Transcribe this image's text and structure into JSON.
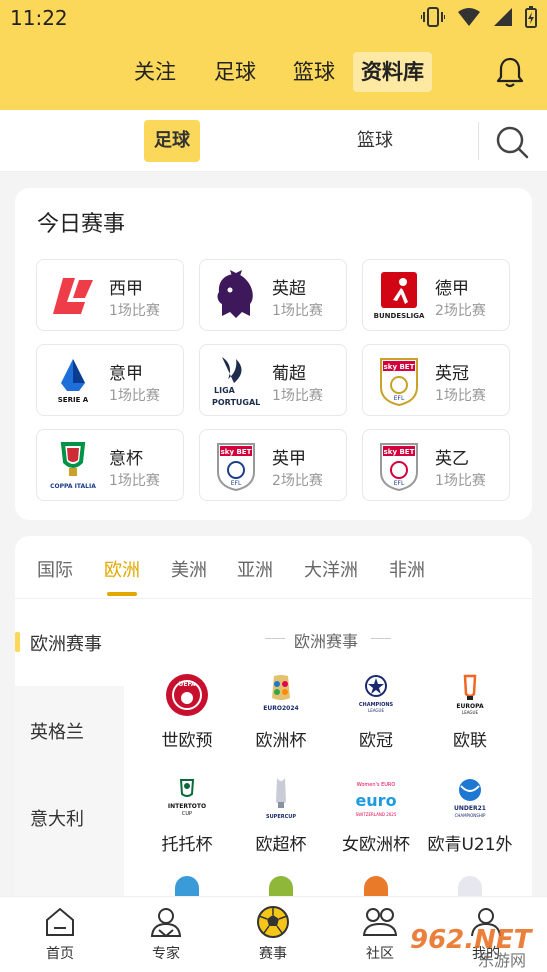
{
  "status": {
    "time": "11:22"
  },
  "header": {
    "tabs": [
      {
        "label": "关注"
      },
      {
        "label": "足球"
      },
      {
        "label": "篮球"
      },
      {
        "label": "资料库"
      }
    ]
  },
  "subtabs": [
    {
      "label": "足球"
    },
    {
      "label": "篮球"
    }
  ],
  "today": {
    "title": "今日赛事",
    "leagues": [
      {
        "name": "西甲",
        "count": "1场比赛",
        "logo": "laliga-logo"
      },
      {
        "name": "英超",
        "count": "1场比赛",
        "logo": "premier-league-logo"
      },
      {
        "name": "德甲",
        "count": "2场比赛",
        "logo": "bundesliga-logo",
        "logo_text": "BUNDESLIGA"
      },
      {
        "name": "意甲",
        "count": "1场比赛",
        "logo": "serie-a-logo",
        "logo_text": "SERIE A"
      },
      {
        "name": "葡超",
        "count": "1场比赛",
        "logo": "liga-portugal-logo",
        "logo_text": "LIGA PORTUGAL"
      },
      {
        "name": "英冠",
        "count": "1场比赛",
        "logo": "efl-championship-logo",
        "logo_text": "sky BET"
      },
      {
        "name": "意杯",
        "count": "1场比赛",
        "logo": "coppa-italia-logo",
        "logo_text": "COPPA ITALIA"
      },
      {
        "name": "英甲",
        "count": "2场比赛",
        "logo": "efl-league-one-logo",
        "logo_text": "sky BET"
      },
      {
        "name": "英乙",
        "count": "1场比赛",
        "logo": "efl-league-two-logo",
        "logo_text": "sky BET"
      }
    ]
  },
  "regions": {
    "tabs": [
      {
        "label": "国际"
      },
      {
        "label": "欧洲"
      },
      {
        "label": "美洲"
      },
      {
        "label": "亚洲"
      },
      {
        "label": "大洋洲"
      },
      {
        "label": "非洲"
      }
    ],
    "sidebar": [
      {
        "label": "欧洲赛事"
      },
      {
        "label": "英格兰"
      },
      {
        "label": "意大利"
      }
    ],
    "section_title": "欧洲赛事",
    "competitions": [
      {
        "name": "世欧预",
        "logo": "uefa-logo",
        "logo_text": "UEFA"
      },
      {
        "name": "欧洲杯",
        "logo": "euro2024-logo",
        "logo_text": "EURO2024"
      },
      {
        "name": "欧冠",
        "logo": "champions-league-logo",
        "logo_text": "CHAMPIONS LEAGUE"
      },
      {
        "name": "欧联",
        "logo": "europa-league-logo",
        "logo_text": "EUROPA LEAGUE"
      },
      {
        "name": "托托杯",
        "logo": "intertoto-logo",
        "logo_text": "INTERTOTO CUP"
      },
      {
        "name": "欧超杯",
        "logo": "supercup-logo",
        "logo_text": "SUPERCUP"
      },
      {
        "name": "女欧洲杯",
        "logo": "womens-euro-logo",
        "logo_text": "euro"
      },
      {
        "name": "欧青U21外",
        "logo": "under21-logo",
        "logo_text": "UNDER21"
      }
    ]
  },
  "bottom_nav": [
    {
      "label": "首页",
      "icon": "home-icon"
    },
    {
      "label": "专家",
      "icon": "experts-icon"
    },
    {
      "label": "赛事",
      "icon": "football-icon"
    },
    {
      "label": "社区",
      "icon": "community-icon"
    },
    {
      "label": "我的",
      "icon": "profile-icon"
    }
  ],
  "watermark": {
    "text": "962.NET",
    "subtext": "乐游网"
  },
  "colors": {
    "accent": "#fbd75a",
    "active_text": "#e3a800"
  }
}
